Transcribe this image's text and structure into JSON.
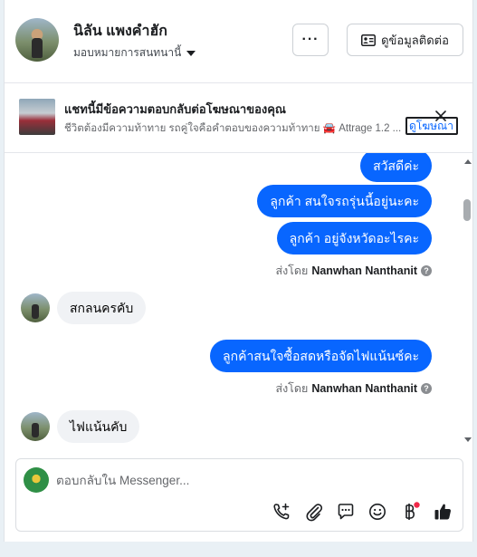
{
  "header": {
    "contact_name": "นิลัน แพงคำฮัก",
    "assign_label": "มอบหมายการสนทนานี้",
    "more_label": "···",
    "contact_info_label": "ดูข้อมูลติดต่อ"
  },
  "ad_banner": {
    "title": "แชทนี้มีข้อความตอบกลับต่อโฆษณาของคุณ",
    "subtitle": "ชีวิตต้องมีความท้าทาย รถคู่ใจคือคำตอบของความท้าทาย 🚘 Attrage 1.2 ...",
    "view_ad_label": "ดูโฆษณา"
  },
  "messages": [
    {
      "direction": "out",
      "text": "สวัสดีค่ะ"
    },
    {
      "direction": "out",
      "text": "ลูกค้า สนใจรถรุ่นนี้อยู่นะคะ"
    },
    {
      "direction": "out",
      "text": "ลูกค้า  อยู่จังหวัดอะไรคะ"
    },
    {
      "direction": "out",
      "text": "ลูกค้าสนใจซื้อสดหรือจัดไฟแน้นซ์คะ"
    }
  ],
  "incoming": [
    {
      "text": "สกลนครคับ"
    },
    {
      "text": "ไฟแน้นคับ"
    }
  ],
  "sent_by": {
    "prefix": "ส่งโดย",
    "name": "Nanwhan Nanthanit",
    "help": "?"
  },
  "composer": {
    "placeholder": "ตอบกลับใน Messenger..."
  },
  "toolbar_icons": [
    "phone-add-icon",
    "paperclip-icon",
    "saved-reply-icon",
    "emoji-icon",
    "baht-payment-icon",
    "thumbs-up-icon"
  ],
  "colors": {
    "accent": "#0866ff",
    "incoming_bubble": "#f0f2f5",
    "notification_dot": "#f02849"
  }
}
